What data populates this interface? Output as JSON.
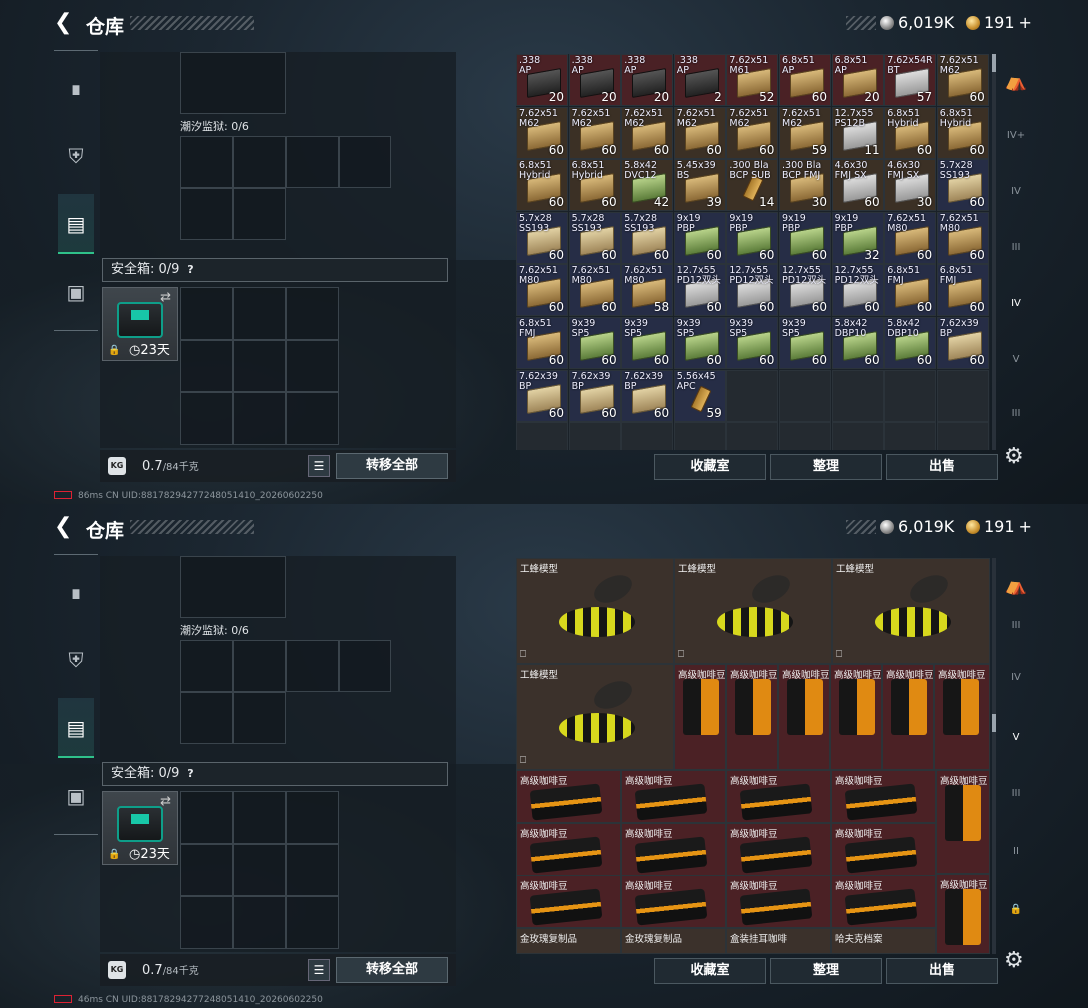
{
  "screen1": {
    "title": "仓库",
    "silver": "6,019K",
    "gold": "191",
    "plus": "+",
    "tide_label": "潮汐监狱: 0/6",
    "safe_label": "安全箱: 0/9",
    "days": "23天",
    "weight": "0.7",
    "weight_cap": "/84千克",
    "transfer_all": "转移全部",
    "buttons": [
      "收藏室",
      "整理",
      "出售"
    ],
    "status": "86ms  CN UID:88178294277248051410_20260602250",
    "ammo": [
      {
        "name": ".338",
        "name2": "AP",
        "qty": "20",
        "tone": "red",
        "img": "dark"
      },
      {
        "name": ".338",
        "name2": "AP",
        "qty": "20",
        "tone": "red",
        "img": "dark"
      },
      {
        "name": ".338",
        "name2": "AP",
        "qty": "20",
        "tone": "red",
        "img": "dark"
      },
      {
        "name": ".338",
        "name2": "AP",
        "qty": "2",
        "tone": "red",
        "img": "dark"
      },
      {
        "name": "7.62x51",
        "name2": "M61",
        "qty": "52",
        "tone": "red",
        "img": "box"
      },
      {
        "name": "6.8x51",
        "name2": "AP",
        "qty": "60",
        "tone": "red",
        "img": "box"
      },
      {
        "name": "6.8x51",
        "name2": "AP",
        "qty": "20",
        "tone": "red",
        "img": "box"
      },
      {
        "name": "7.62x54R",
        "name2": "BT",
        "qty": "57",
        "tone": "red",
        "img": "white"
      },
      {
        "name": "7.62x51",
        "name2": "M62",
        "qty": "60",
        "tone": "brown",
        "img": "box"
      },
      {
        "name": "7.62x51",
        "name2": "M62",
        "qty": "60",
        "tone": "brown",
        "img": "box"
      },
      {
        "name": "7.62x51",
        "name2": "M62",
        "qty": "60",
        "tone": "brown",
        "img": "box"
      },
      {
        "name": "7.62x51",
        "name2": "M62",
        "qty": "60",
        "tone": "brown",
        "img": "box"
      },
      {
        "name": "7.62x51",
        "name2": "M62",
        "qty": "60",
        "tone": "brown",
        "img": "box"
      },
      {
        "name": "7.62x51",
        "name2": "M62",
        "qty": "60",
        "tone": "brown",
        "img": "box"
      },
      {
        "name": "7.62x51",
        "name2": "M62",
        "qty": "59",
        "tone": "brown",
        "img": "box"
      },
      {
        "name": "12.7x55",
        "name2": "PS12B",
        "qty": "11",
        "tone": "brown",
        "img": "white"
      },
      {
        "name": "6.8x51",
        "name2": "Hybrid",
        "qty": "60",
        "tone": "brown",
        "img": "box"
      },
      {
        "name": "6.8x51",
        "name2": "Hybrid",
        "qty": "60",
        "tone": "brown",
        "img": "box"
      },
      {
        "name": "6.8x51",
        "name2": "Hybrid",
        "qty": "60",
        "tone": "brown",
        "img": "box"
      },
      {
        "name": "6.8x51",
        "name2": "Hybrid",
        "qty": "60",
        "tone": "brown",
        "img": "box"
      },
      {
        "name": "5.8x42",
        "name2": "DVC12",
        "qty": "42",
        "tone": "brown",
        "img": "green"
      },
      {
        "name": "5.45x39",
        "name2": "BS",
        "qty": "39",
        "tone": "brown",
        "img": "box"
      },
      {
        "name": ".300 Bla",
        "name2": "BCP SUB",
        "qty": "14",
        "tone": "brown",
        "img": "bullet"
      },
      {
        "name": ".300 Bla",
        "name2": "BCP FMJ",
        "qty": "30",
        "tone": "brown",
        "img": "box"
      },
      {
        "name": "4.6x30",
        "name2": "FMJ SX",
        "qty": "60",
        "tone": "brown",
        "img": "white"
      },
      {
        "name": "4.6x30",
        "name2": "FMJ SX",
        "qty": "30",
        "tone": "brown",
        "img": "white"
      },
      {
        "name": "5.7x28",
        "name2": "SS193",
        "qty": "60",
        "tone": "navy",
        "img": "tan"
      },
      {
        "name": "5.7x28",
        "name2": "SS193",
        "qty": "60",
        "tone": "navy",
        "img": "tan"
      },
      {
        "name": "5.7x28",
        "name2": "SS193",
        "qty": "60",
        "tone": "navy",
        "img": "tan"
      },
      {
        "name": "5.7x28",
        "name2": "SS193",
        "qty": "60",
        "tone": "navy",
        "img": "tan"
      },
      {
        "name": "9x19",
        "name2": "PBP",
        "qty": "60",
        "tone": "navy",
        "img": "green"
      },
      {
        "name": "9x19",
        "name2": "PBP",
        "qty": "60",
        "tone": "navy",
        "img": "green"
      },
      {
        "name": "9x19",
        "name2": "PBP",
        "qty": "60",
        "tone": "navy",
        "img": "green"
      },
      {
        "name": "9x19",
        "name2": "PBP",
        "qty": "32",
        "tone": "navy",
        "img": "green"
      },
      {
        "name": "7.62x51",
        "name2": "M80",
        "qty": "60",
        "tone": "navy",
        "img": "box"
      },
      {
        "name": "7.62x51",
        "name2": "M80",
        "qty": "60",
        "tone": "navy",
        "img": "box"
      },
      {
        "name": "7.62x51",
        "name2": "M80",
        "qty": "60",
        "tone": "navy",
        "img": "box"
      },
      {
        "name": "7.62x51",
        "name2": "M80",
        "qty": "60",
        "tone": "navy",
        "img": "box"
      },
      {
        "name": "7.62x51",
        "name2": "M80",
        "qty": "58",
        "tone": "navy",
        "img": "box"
      },
      {
        "name": "12.7x55",
        "name2": "PD12双头",
        "qty": "60",
        "tone": "navy",
        "img": "white"
      },
      {
        "name": "12.7x55",
        "name2": "PD12双头",
        "qty": "60",
        "tone": "navy",
        "img": "white"
      },
      {
        "name": "12.7x55",
        "name2": "PD12双头",
        "qty": "60",
        "tone": "navy",
        "img": "white"
      },
      {
        "name": "12.7x55",
        "name2": "PD12双头",
        "qty": "60",
        "tone": "navy",
        "img": "white"
      },
      {
        "name": "6.8x51",
        "name2": "FMJ",
        "qty": "60",
        "tone": "navy",
        "img": "box"
      },
      {
        "name": "6.8x51",
        "name2": "FMJ",
        "qty": "60",
        "tone": "navy",
        "img": "box"
      },
      {
        "name": "6.8x51",
        "name2": "FMJ",
        "qty": "60",
        "tone": "navy",
        "img": "box"
      },
      {
        "name": "9x39",
        "name2": "SP5",
        "qty": "60",
        "tone": "navy",
        "img": "green"
      },
      {
        "name": "9x39",
        "name2": "SP5",
        "qty": "60",
        "tone": "navy",
        "img": "green"
      },
      {
        "name": "9x39",
        "name2": "SP5",
        "qty": "60",
        "tone": "navy",
        "img": "green"
      },
      {
        "name": "9x39",
        "name2": "SP5",
        "qty": "60",
        "tone": "navy",
        "img": "green"
      },
      {
        "name": "9x39",
        "name2": "SP5",
        "qty": "60",
        "tone": "navy",
        "img": "green"
      },
      {
        "name": "5.8x42",
        "name2": "DBP10",
        "qty": "60",
        "tone": "navy",
        "img": "green"
      },
      {
        "name": "5.8x42",
        "name2": "DBP10",
        "qty": "60",
        "tone": "navy",
        "img": "green"
      },
      {
        "name": "7.62x39",
        "name2": "BP",
        "qty": "60",
        "tone": "navy",
        "img": "tan"
      },
      {
        "name": "7.62x39",
        "name2": "BP",
        "qty": "60",
        "tone": "navy",
        "img": "tan"
      },
      {
        "name": "7.62x39",
        "name2": "BP",
        "qty": "60",
        "tone": "navy",
        "img": "tan"
      },
      {
        "name": "7.62x39",
        "name2": "BP",
        "qty": "60",
        "tone": "navy",
        "img": "tan"
      },
      {
        "name": "5.56x45",
        "name2": "APC",
        "qty": "59",
        "tone": "navy",
        "img": "bullet"
      }
    ]
  },
  "screen2": {
    "title": "仓库",
    "silver": "6,019K",
    "gold": "191",
    "plus": "+",
    "tide_label": "潮汐监狱: 0/6",
    "safe_label": "安全箱: 0/9",
    "days": "23天",
    "weight": "0.7",
    "weight_cap": "/84千克",
    "transfer_all": "转移全部",
    "buttons": [
      "收藏室",
      "整理",
      "出售"
    ],
    "status": "46ms  CN UID:88178294277248051410_20260602250",
    "bee_name": "工蜂模型",
    "coffee_name": "高级咖啡豆",
    "bottom_items": [
      "金玫瑰复制品",
      "金玫瑰复制品",
      "盒装挂耳咖啡",
      "哈夫克档案"
    ]
  },
  "colors": {
    "accent": "#2fc28b",
    "red_tile": "#4a2125",
    "navy_tile": "#262d46",
    "brown_tile": "#3b3025"
  }
}
